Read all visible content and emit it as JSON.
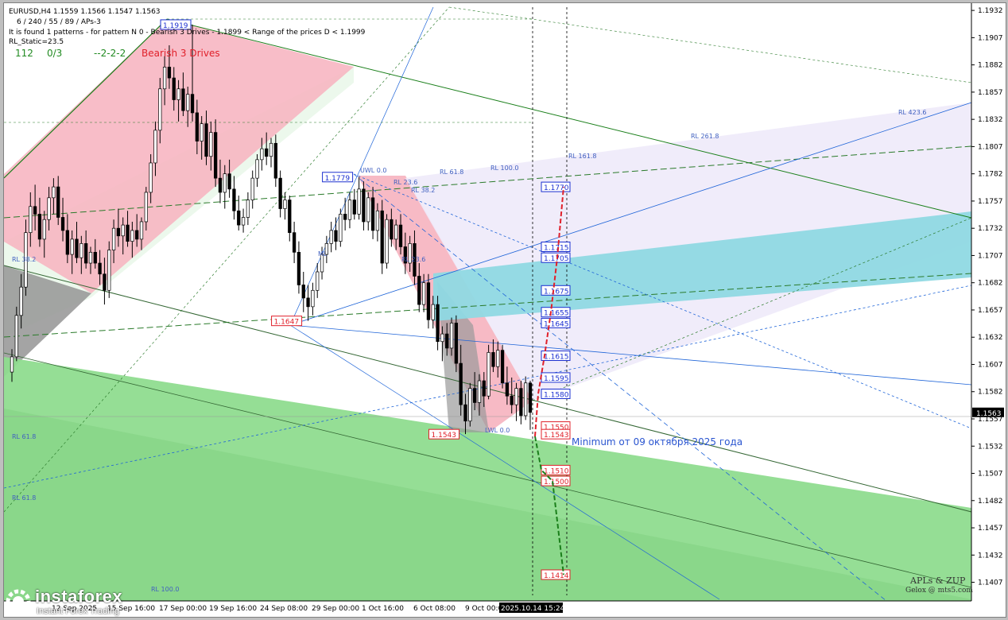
{
  "header": {
    "line1": "EURUSD,H4  1.1559 1.1566 1.1547 1.1563",
    "line2": "6 / 240 / 55 / 89 / APs-3",
    "line3": "It is found 1 patterns  -  for pattern N 0 - Bearish 3 Drives - 1.1899 < Range of the prices D < 1.1999",
    "line4": "RL_Static=23.5",
    "count": "112",
    "ratio": "0/3",
    "code": "--2-2-2",
    "pattern": "Bearish 3 Drives"
  },
  "watermark": {
    "line1": "APLs & ZUP",
    "line2": "Gelox @ mts5.com"
  },
  "logo": {
    "name": "instaforex",
    "tagline": "Instant Forex Trading"
  },
  "colors": {
    "bull_candle": "#ffffff",
    "bear_candle": "#000000",
    "level_red": "#e0202a",
    "level_blue": "#1a2fd0",
    "pink_zone": "#f7b6c2",
    "green_zone": "#8fdc8f",
    "cyan_zone": "#8fd9e3",
    "lavender_zone": "#eeeafa"
  },
  "annotation": "Minimum от 09 октября 2025 года",
  "fib_labels": [
    "UWL 0.0",
    "RL 23.6",
    "RL 38.2",
    "RL 61.8",
    "RL 100.0",
    "RL 161.8",
    "RL 261.8",
    "RL 423.6",
    "RL 38.2",
    "RL 61.8",
    "RL 100.0",
    "RL 61.8",
    "LWL 0.0",
    "RL 23.6",
    "ML"
  ],
  "chart_data": {
    "type": "candlestick",
    "symbol": "EURUSD",
    "timeframe": "H4",
    "ylim": [
      1.1395,
      1.1935
    ],
    "y_ticks": [
      "1.1932",
      "1.1907",
      "1.1882",
      "1.1857",
      "1.1832",
      "1.1807",
      "1.1782",
      "1.1757",
      "1.1732",
      "1.1707",
      "1.1682",
      "1.1657",
      "1.1632",
      "1.1607",
      "1.1582",
      "1.1557",
      "1.1532",
      "1.1507",
      "1.1482",
      "1.1457",
      "1.1432",
      "1.1407"
    ],
    "x_ticks": [
      "12 Sep 2025",
      "15 Sep 16:00",
      "17 Sep 00:00",
      "19 Sep 16:00",
      "24 Sep 08:00",
      "29 Sep 00:00",
      "1 Oct 16:00",
      "6 Oct 08:00",
      "9 Oct 00:00",
      "2025.10.14 15:24"
    ],
    "current_price": "1.1563",
    "pattern_points": [
      {
        "label": "1.1919",
        "value": 1.1919
      },
      {
        "label": "1.1779",
        "value": 1.1779
      },
      {
        "label": "1.1647",
        "value": 1.1647
      },
      {
        "label": "1.1543",
        "value": 1.1543
      }
    ],
    "target_levels": [
      {
        "label": "1.1770",
        "value": 1.177,
        "kind": "up"
      },
      {
        "label": "1.1715",
        "value": 1.1715,
        "kind": "up"
      },
      {
        "label": "1.1705",
        "value": 1.1705,
        "kind": "up"
      },
      {
        "label": "1.1675",
        "value": 1.1675,
        "kind": "up"
      },
      {
        "label": "1.1655",
        "value": 1.1655,
        "kind": "up"
      },
      {
        "label": "1.1645",
        "value": 1.1645,
        "kind": "up"
      },
      {
        "label": "1.1615",
        "value": 1.1615,
        "kind": "up"
      },
      {
        "label": "1.1595",
        "value": 1.1595,
        "kind": "up"
      },
      {
        "label": "1.1580",
        "value": 1.158,
        "kind": "up"
      },
      {
        "label": "1.1550",
        "value": 1.155,
        "kind": "down"
      },
      {
        "label": "1.1543",
        "value": 1.1543,
        "kind": "down"
      },
      {
        "label": "1.1510",
        "value": 1.151,
        "kind": "down"
      },
      {
        "label": "1.1500",
        "value": 1.15,
        "kind": "down"
      },
      {
        "label": "1.1414",
        "value": 1.1414,
        "kind": "down"
      }
    ],
    "candles": [
      [
        1.16,
        1.1621,
        1.1591,
        1.1614
      ],
      [
        1.1614,
        1.166,
        1.161,
        1.1652
      ],
      [
        1.1652,
        1.169,
        1.164,
        1.1678
      ],
      [
        1.1678,
        1.174,
        1.167,
        1.1728
      ],
      [
        1.1728,
        1.1765,
        1.1715,
        1.1752
      ],
      [
        1.1752,
        1.1772,
        1.173,
        1.1745
      ],
      [
        1.1745,
        1.176,
        1.1715,
        1.1722
      ],
      [
        1.1722,
        1.1748,
        1.1705,
        1.174
      ],
      [
        1.174,
        1.177,
        1.173,
        1.176
      ],
      [
        1.176,
        1.1778,
        1.1745,
        1.177
      ],
      [
        1.177,
        1.178,
        1.1735,
        1.1742
      ],
      [
        1.1742,
        1.176,
        1.172,
        1.173
      ],
      [
        1.173,
        1.1745,
        1.17,
        1.1708
      ],
      [
        1.1708,
        1.173,
        1.169,
        1.1722
      ],
      [
        1.1722,
        1.1738,
        1.17,
        1.1705
      ],
      [
        1.1705,
        1.1725,
        1.169,
        1.1718
      ],
      [
        1.1718,
        1.173,
        1.1695,
        1.17
      ],
      [
        1.17,
        1.1715,
        1.169,
        1.171
      ],
      [
        1.171,
        1.1722,
        1.1695,
        1.17
      ],
      [
        1.17,
        1.1712,
        1.168,
        1.169
      ],
      [
        1.169,
        1.1705,
        1.1662,
        1.1675
      ],
      [
        1.1675,
        1.172,
        1.1668,
        1.1712
      ],
      [
        1.1712,
        1.174,
        1.17,
        1.1732
      ],
      [
        1.1732,
        1.175,
        1.1715,
        1.1725
      ],
      [
        1.1725,
        1.1742,
        1.1708,
        1.1735
      ],
      [
        1.1735,
        1.1748,
        1.1715,
        1.172
      ],
      [
        1.172,
        1.1738,
        1.1705,
        1.173
      ],
      [
        1.173,
        1.1745,
        1.1715,
        1.1722
      ],
      [
        1.1722,
        1.1742,
        1.1712,
        1.1738
      ],
      [
        1.1738,
        1.177,
        1.173,
        1.1765
      ],
      [
        1.1765,
        1.18,
        1.1755,
        1.1792
      ],
      [
        1.1792,
        1.183,
        1.178,
        1.1822
      ],
      [
        1.1822,
        1.187,
        1.181,
        1.186
      ],
      [
        1.186,
        1.189,
        1.1845,
        1.188
      ],
      [
        1.188,
        1.19,
        1.186,
        1.187
      ],
      [
        1.187,
        1.188,
        1.184,
        1.185
      ],
      [
        1.185,
        1.1868,
        1.183,
        1.186
      ],
      [
        1.186,
        1.1875,
        1.1835,
        1.184
      ],
      [
        1.184,
        1.1862,
        1.1825,
        1.1855
      ],
      [
        1.1855,
        1.1919,
        1.183,
        1.1838
      ],
      [
        1.1838,
        1.185,
        1.18,
        1.1812
      ],
      [
        1.1812,
        1.1835,
        1.1795,
        1.1828
      ],
      [
        1.1828,
        1.184,
        1.179,
        1.1798
      ],
      [
        1.1798,
        1.183,
        1.1785,
        1.182
      ],
      [
        1.182,
        1.1832,
        1.177,
        1.1778
      ],
      [
        1.1778,
        1.1795,
        1.1755,
        1.1765
      ],
      [
        1.1765,
        1.179,
        1.175,
        1.1782
      ],
      [
        1.1782,
        1.1795,
        1.176,
        1.1768
      ],
      [
        1.1768,
        1.178,
        1.174,
        1.1748
      ],
      [
        1.1748,
        1.1762,
        1.173,
        1.1735
      ],
      [
        1.1735,
        1.175,
        1.1728,
        1.1742
      ],
      [
        1.1742,
        1.1765,
        1.1735,
        1.1758
      ],
      [
        1.1758,
        1.1785,
        1.175,
        1.1778
      ],
      [
        1.1778,
        1.18,
        1.177,
        1.1795
      ],
      [
        1.1795,
        1.1815,
        1.1785,
        1.1805
      ],
      [
        1.1805,
        1.182,
        1.179,
        1.1798
      ],
      [
        1.1798,
        1.1815,
        1.1788,
        1.181
      ],
      [
        1.181,
        1.1818,
        1.177,
        1.1778
      ],
      [
        1.1778,
        1.1785,
        1.1742,
        1.175
      ],
      [
        1.175,
        1.1765,
        1.174,
        1.1758
      ],
      [
        1.1758,
        1.1762,
        1.172,
        1.1728
      ],
      [
        1.1728,
        1.1738,
        1.17,
        1.171
      ],
      [
        1.171,
        1.172,
        1.1672,
        1.168
      ],
      [
        1.168,
        1.1692,
        1.1655,
        1.1668
      ],
      [
        1.1668,
        1.168,
        1.1647,
        1.166
      ],
      [
        1.166,
        1.1682,
        1.1652,
        1.1675
      ],
      [
        1.1675,
        1.17,
        1.1668,
        1.1692
      ],
      [
        1.1692,
        1.1715,
        1.1685,
        1.1708
      ],
      [
        1.1708,
        1.1725,
        1.17,
        1.1718
      ],
      [
        1.1718,
        1.1738,
        1.171,
        1.173
      ],
      [
        1.173,
        1.1742,
        1.1712,
        1.172
      ],
      [
        1.172,
        1.175,
        1.1715,
        1.1745
      ],
      [
        1.1745,
        1.176,
        1.173,
        1.174
      ],
      [
        1.174,
        1.1765,
        1.1732,
        1.1758
      ],
      [
        1.1758,
        1.1768,
        1.174,
        1.1745
      ],
      [
        1.1745,
        1.1779,
        1.174,
        1.1768
      ],
      [
        1.1768,
        1.1775,
        1.173,
        1.1738
      ],
      [
        1.1738,
        1.1765,
        1.173,
        1.176
      ],
      [
        1.176,
        1.177,
        1.1722,
        1.173
      ],
      [
        1.173,
        1.1755,
        1.172,
        1.1748
      ],
      [
        1.1748,
        1.1758,
        1.169,
        1.17
      ],
      [
        1.17,
        1.1745,
        1.1695,
        1.174
      ],
      [
        1.174,
        1.175,
        1.1715,
        1.1722
      ],
      [
        1.1722,
        1.174,
        1.1712,
        1.1735
      ],
      [
        1.1735,
        1.1745,
        1.1708,
        1.1715
      ],
      [
        1.1715,
        1.1728,
        1.169,
        1.17
      ],
      [
        1.17,
        1.1725,
        1.1692,
        1.1718
      ],
      [
        1.1718,
        1.173,
        1.168,
        1.1688
      ],
      [
        1.1688,
        1.17,
        1.1655,
        1.1662
      ],
      [
        1.1662,
        1.169,
        1.1655,
        1.1682
      ],
      [
        1.1682,
        1.169,
        1.164,
        1.1648
      ],
      [
        1.1648,
        1.167,
        1.164,
        1.1662
      ],
      [
        1.1662,
        1.167,
        1.162,
        1.1628
      ],
      [
        1.1628,
        1.1642,
        1.161,
        1.1635
      ],
      [
        1.1635,
        1.1645,
        1.1615,
        1.1622
      ],
      [
        1.1622,
        1.165,
        1.1615,
        1.1645
      ],
      [
        1.1645,
        1.1652,
        1.16,
        1.1608
      ],
      [
        1.1608,
        1.1625,
        1.156,
        1.157
      ],
      [
        1.157,
        1.158,
        1.1543,
        1.1555
      ],
      [
        1.1555,
        1.159,
        1.155,
        1.1585
      ],
      [
        1.1585,
        1.16,
        1.1565,
        1.1572
      ],
      [
        1.1572,
        1.1598,
        1.156,
        1.1592
      ],
      [
        1.1592,
        1.16,
        1.1568,
        1.1578
      ],
      [
        1.1578,
        1.1625,
        1.1575,
        1.1618
      ],
      [
        1.1618,
        1.163,
        1.16,
        1.1605
      ],
      [
        1.1605,
        1.1628,
        1.1595,
        1.162
      ],
      [
        1.162,
        1.1625,
        1.1585,
        1.159
      ],
      [
        1.159,
        1.1605,
        1.157,
        1.1578
      ],
      [
        1.1578,
        1.1595,
        1.1562,
        1.157
      ],
      [
        1.157,
        1.159,
        1.1555,
        1.1585
      ],
      [
        1.1585,
        1.1592,
        1.1552,
        1.156
      ],
      [
        1.156,
        1.1596,
        1.1556,
        1.159
      ],
      [
        1.159,
        1.1592,
        1.1547,
        1.1563
      ]
    ]
  }
}
